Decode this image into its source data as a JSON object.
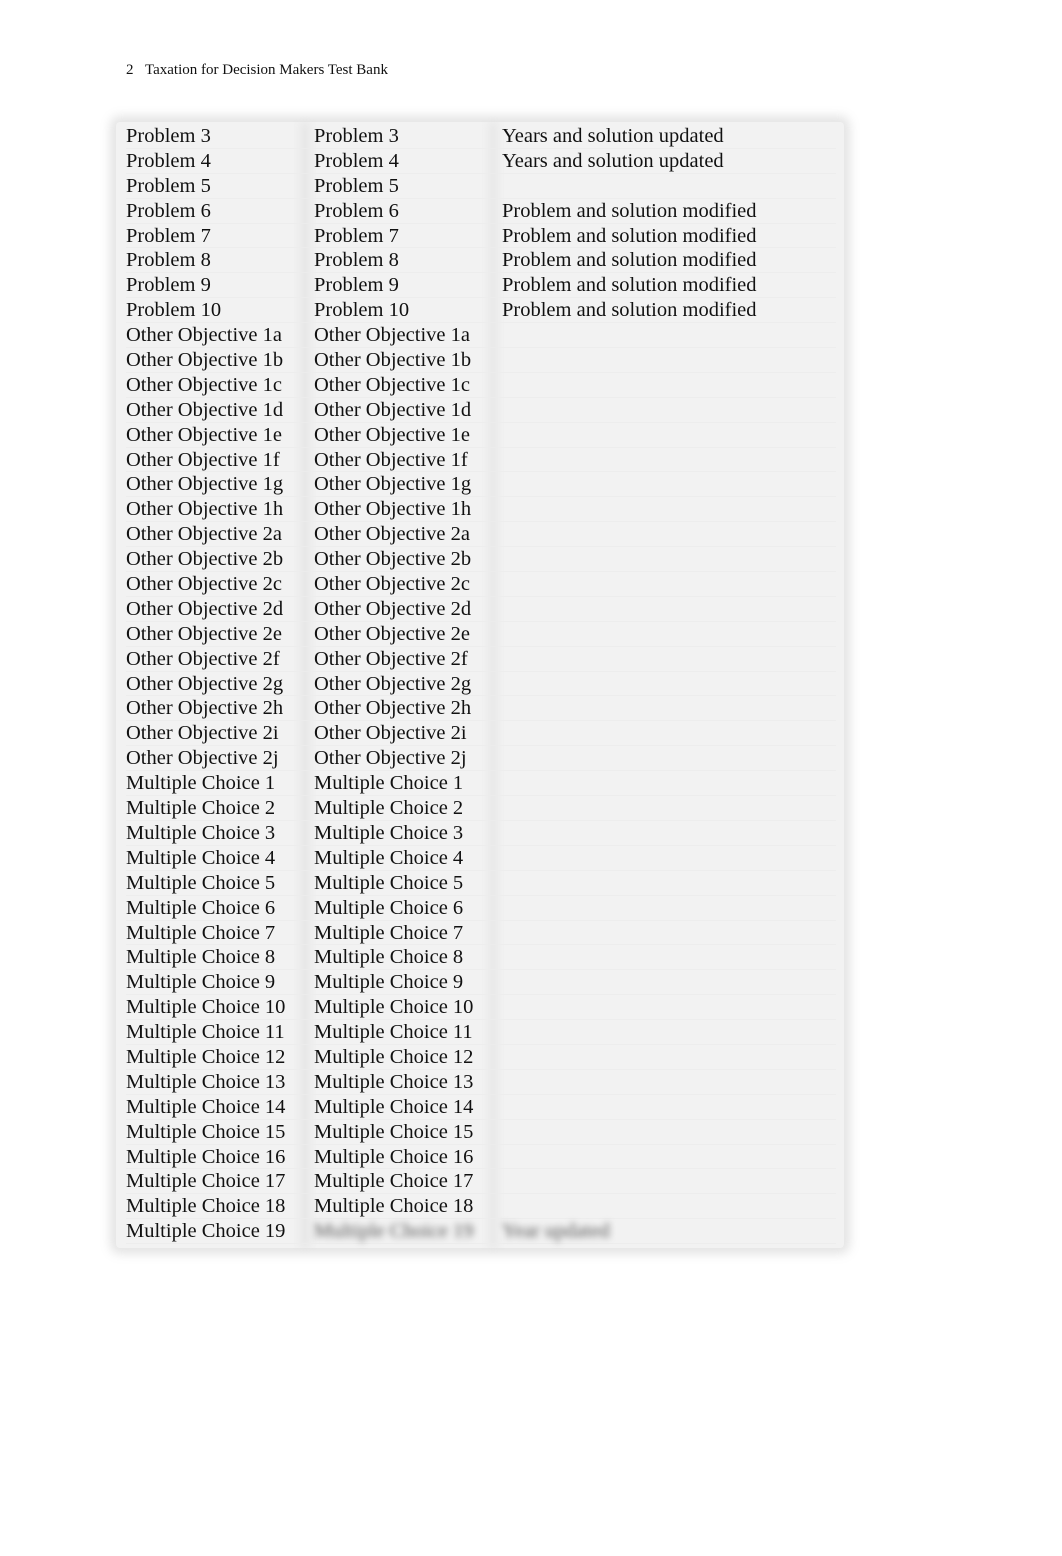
{
  "header": {
    "page_number": "2",
    "title": "Taxation for Decision Makers Test Bank"
  },
  "table": {
    "rows": [
      {
        "col1": "Problem 3",
        "col2": "Problem 3",
        "col3": "Years and solution updated"
      },
      {
        "col1": "Problem 4",
        "col2": "Problem 4",
        "col3": "Years and solution updated"
      },
      {
        "col1": "Problem 5",
        "col2": "Problem 5",
        "col3": ""
      },
      {
        "col1": "Problem 6",
        "col2": "Problem 6",
        "col3": "Problem and solution modified"
      },
      {
        "col1": "Problem 7",
        "col2": "Problem 7",
        "col3": "Problem and solution modified"
      },
      {
        "col1": "Problem 8",
        "col2": "Problem 8",
        "col3": "Problem and solution modified"
      },
      {
        "col1": "Problem 9",
        "col2": "Problem 9",
        "col3": "Problem and solution modified"
      },
      {
        "col1": "Problem 10",
        "col2": "Problem 10",
        "col3": "Problem and solution modified"
      },
      {
        "col1": "Other Objective 1a",
        "col2": "Other Objective 1a",
        "col3": ""
      },
      {
        "col1": "Other Objective 1b",
        "col2": "Other Objective 1b",
        "col3": ""
      },
      {
        "col1": "Other Objective 1c",
        "col2": "Other Objective 1c",
        "col3": ""
      },
      {
        "col1": "Other Objective 1d",
        "col2": "Other Objective 1d",
        "col3": ""
      },
      {
        "col1": "Other Objective 1e",
        "col2": "Other Objective 1e",
        "col3": ""
      },
      {
        "col1": "Other Objective 1f",
        "col2": "Other Objective 1f",
        "col3": ""
      },
      {
        "col1": "Other Objective 1g",
        "col2": "Other Objective 1g",
        "col3": ""
      },
      {
        "col1": "Other Objective 1h",
        "col2": "Other Objective 1h",
        "col3": ""
      },
      {
        "col1": "Other Objective 2a",
        "col2": "Other Objective 2a",
        "col3": ""
      },
      {
        "col1": "Other Objective 2b",
        "col2": "Other Objective 2b",
        "col3": ""
      },
      {
        "col1": "Other Objective 2c",
        "col2": "Other Objective 2c",
        "col3": ""
      },
      {
        "col1": "Other Objective 2d",
        "col2": "Other Objective 2d",
        "col3": ""
      },
      {
        "col1": "Other Objective 2e",
        "col2": "Other Objective 2e",
        "col3": ""
      },
      {
        "col1": "Other Objective 2f",
        "col2": "Other Objective 2f",
        "col3": ""
      },
      {
        "col1": "Other Objective 2g",
        "col2": "Other Objective 2g",
        "col3": ""
      },
      {
        "col1": "Other Objective 2h",
        "col2": "Other Objective 2h",
        "col3": ""
      },
      {
        "col1": "Other Objective 2i",
        "col2": "Other Objective 2i",
        "col3": ""
      },
      {
        "col1": "Other Objective 2j",
        "col2": "Other Objective 2j",
        "col3": ""
      },
      {
        "col1": "Multiple Choice 1",
        "col2": "Multiple Choice 1",
        "col3": ""
      },
      {
        "col1": "Multiple Choice 2",
        "col2": "Multiple Choice 2",
        "col3": ""
      },
      {
        "col1": "Multiple Choice 3",
        "col2": "Multiple Choice 3",
        "col3": ""
      },
      {
        "col1": "Multiple Choice 4",
        "col2": "Multiple Choice 4",
        "col3": ""
      },
      {
        "col1": "Multiple Choice 5",
        "col2": "Multiple Choice 5",
        "col3": ""
      },
      {
        "col1": "Multiple Choice 6",
        "col2": "Multiple Choice 6",
        "col3": ""
      },
      {
        "col1": "Multiple Choice 7",
        "col2": "Multiple Choice 7",
        "col3": ""
      },
      {
        "col1": "Multiple Choice 8",
        "col2": "Multiple Choice 8",
        "col3": ""
      },
      {
        "col1": "Multiple Choice 9",
        "col2": "Multiple Choice 9",
        "col3": ""
      },
      {
        "col1": "Multiple Choice 10",
        "col2": "Multiple Choice 10",
        "col3": ""
      },
      {
        "col1": "Multiple Choice 11",
        "col2": "Multiple Choice 11",
        "col3": ""
      },
      {
        "col1": "Multiple Choice 12",
        "col2": "Multiple Choice 12",
        "col3": ""
      },
      {
        "col1": "Multiple Choice 13",
        "col2": "Multiple Choice 13",
        "col3": ""
      },
      {
        "col1": "Multiple Choice 14",
        "col2": "Multiple Choice 14",
        "col3": ""
      },
      {
        "col1": "Multiple Choice 15",
        "col2": "Multiple Choice 15",
        "col3": ""
      },
      {
        "col1": "Multiple Choice 16",
        "col2": "Multiple Choice 16",
        "col3": ""
      },
      {
        "col1": "Multiple Choice 17",
        "col2": "Multiple Choice 17",
        "col3": ""
      },
      {
        "col1": "Multiple Choice 18",
        "col2": "Multiple Choice 18",
        "col3": ""
      },
      {
        "col1": "Multiple Choice 19",
        "col2": "Multiple Choice 19",
        "col3": "Year updated",
        "blurred_cols": [
          2,
          3
        ]
      }
    ]
  }
}
